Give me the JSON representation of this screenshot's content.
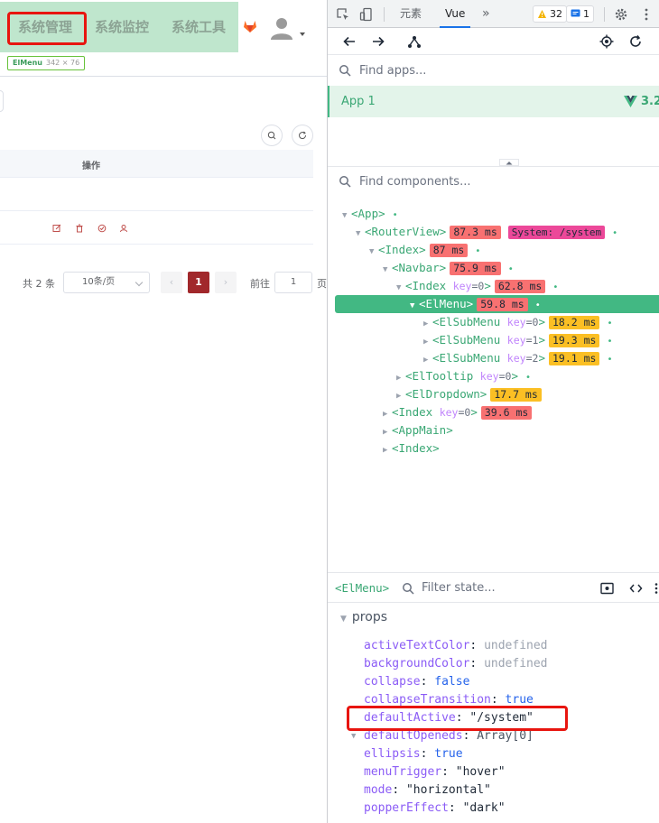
{
  "app": {
    "menu": [
      {
        "label": "系统管理",
        "active": true
      },
      {
        "label": "系统监控",
        "active": false
      },
      {
        "label": "系统工具",
        "active": false
      }
    ],
    "inspector_chip": {
      "name": "ElMenu",
      "size": "342 × 76"
    },
    "table": {
      "header_ops": "操作"
    },
    "pagination": {
      "total": "共 2 条",
      "page_size": "10条/页",
      "prev": "‹",
      "current": "1",
      "next": "›",
      "goto": "前往",
      "jump_value": "1",
      "page_suffix": "页"
    },
    "colors": {
      "menu_bg": "#bfe6cd",
      "accent": "#a1282b",
      "highlight": "#e8150f"
    }
  },
  "devtools": {
    "tabs": {
      "elements": "元素",
      "vue": "Vue",
      "more": "»"
    },
    "badges": {
      "warnings": "32",
      "messages": "1"
    },
    "find_apps_placeholder": "Find apps...",
    "app": {
      "name": "App 1",
      "version": "3.2."
    },
    "find_components_placeholder": "Find components...",
    "tree": [
      {
        "tag": "<App>",
        "dot": "•"
      },
      {
        "tag": "<RouterView>",
        "ms": "87.3 ms",
        "route": "System: /system",
        "dot": "•"
      },
      {
        "tag": "<Index>",
        "ms": "87 ms",
        "dot": "•"
      },
      {
        "tag": "<Navbar>",
        "ms": "75.9 ms",
        "dot": "•"
      },
      {
        "tag": "<Index",
        "key": "key",
        "keyval": "=0",
        "close": ">",
        "ms": "62.8 ms",
        "dot": "•"
      },
      {
        "tag": "<ElMenu>",
        "ms": "59.8 ms",
        "dot": "•",
        "selected": true
      },
      {
        "tag": "<ElSubMenu",
        "key": "key",
        "keyval": "=0",
        "close": ">",
        "ms": "18.2 ms",
        "dot": "•"
      },
      {
        "tag": "<ElSubMenu",
        "key": "key",
        "keyval": "=1",
        "close": ">",
        "ms": "19.3 ms",
        "dot": "•"
      },
      {
        "tag": "<ElSubMenu",
        "key": "key",
        "keyval": "=2",
        "close": ">",
        "ms": "19.1 ms",
        "dot": "•"
      },
      {
        "tag": "<ElTooltip",
        "key": "key",
        "keyval": "=0",
        "close": ">",
        "dot": "•"
      },
      {
        "tag": "<ElDropdown>",
        "ms": "17.7 ms"
      },
      {
        "tag": "<Index",
        "key": "key",
        "keyval": "=0",
        "close": ">",
        "ms": "39.6 ms"
      },
      {
        "tag": "<AppMain>"
      },
      {
        "tag": "<Index>"
      }
    ],
    "state": {
      "component": "<ElMenu>",
      "filter_placeholder": "Filter state...",
      "section": "props",
      "props": [
        {
          "key": "activeTextColor",
          "value": "undefined",
          "kind": "undef"
        },
        {
          "key": "backgroundColor",
          "value": "undefined",
          "kind": "undef"
        },
        {
          "key": "collapse",
          "value": "false",
          "kind": "bool"
        },
        {
          "key": "collapseTransition",
          "value": "true",
          "kind": "bool"
        },
        {
          "key": "defaultActive",
          "value": "\"/system\"",
          "kind": "str"
        },
        {
          "key": "defaultOpeneds",
          "value": "Array[0]",
          "kind": "arr"
        },
        {
          "key": "ellipsis",
          "value": "true",
          "kind": "bool"
        },
        {
          "key": "menuTrigger",
          "value": "\"hover\"",
          "kind": "str"
        },
        {
          "key": "mode",
          "value": "\"horizontal\"",
          "kind": "str"
        },
        {
          "key": "popperEffect",
          "value": "\"dark\"",
          "kind": "str"
        }
      ]
    }
  }
}
